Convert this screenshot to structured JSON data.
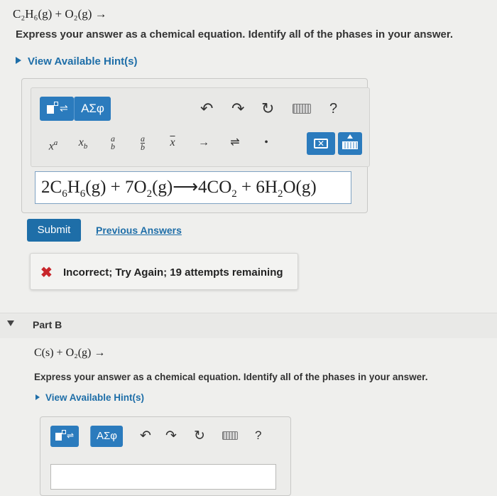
{
  "part_a": {
    "question": "C₂H₆(g) + O₂(g) →",
    "instruction": "Express your answer as a chemical equation. Identify all of the phases in your answer.",
    "hint_link": "View Available Hint(s)",
    "toolbar": {
      "greek_label": "ΑΣφ",
      "help_label": "?",
      "symbols": {
        "superscript": "x",
        "superscript_exp": "a",
        "subscript": "x",
        "subscript_exp": "b",
        "fraction_top": "a",
        "fraction_bottom": "b",
        "bar": "x",
        "right_arrow": "→",
        "equilibrium": "⇌",
        "dot": "•",
        "delete": "✕"
      },
      "icons": [
        "template-icon",
        "undo-icon",
        "redo-icon",
        "reset-icon",
        "keyboard-icon",
        "help-icon"
      ]
    },
    "answer": {
      "c1": "2C",
      "s1": "6",
      "c2": "H",
      "s2": "6",
      "c3": "(g) + 7O",
      "s3": "2",
      "c4": "(g)⟶4CO",
      "s4": "2",
      "c5": " + 6H",
      "s5": "2",
      "c6": "O(g)"
    },
    "submit_label": "Submit",
    "previous_answers_label": "Previous Answers",
    "feedback": {
      "icon": "✖",
      "text": "Incorrect; Try Again; 19 attempts remaining"
    }
  },
  "part_b": {
    "label": "Part B",
    "question": "C(s) + O₂(g) →",
    "instruction": "Express your answer as a chemical equation. Identify all of the phases in your answer.",
    "hint_link": "View Available Hint(s)",
    "toolbar": {
      "greek_label": "ΑΣφ",
      "help_label": "?"
    },
    "answer_value": ""
  },
  "colors": {
    "accent": "#2b7bbd",
    "link": "#1e6ea8",
    "error": "#c8262b",
    "background": "#efefed"
  }
}
